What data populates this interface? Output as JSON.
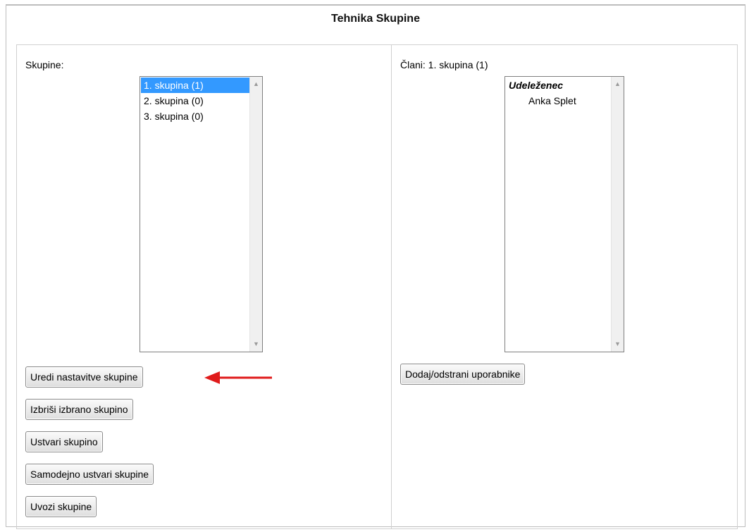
{
  "title": "Tehnika Skupine",
  "groups": {
    "label": "Skupine:",
    "items": [
      "1. skupina (1)",
      "2. skupina (0)",
      "3. skupina (0)"
    ],
    "selected_index": 0,
    "buttons": {
      "edit": "Uredi nastavitve skupine",
      "delete": "Izbriši izbrano skupino",
      "create": "Ustvari skupino",
      "auto_create": "Samodejno ustvari skupine",
      "import": "Uvozi skupine"
    }
  },
  "members": {
    "label": "Člani: 1. skupina (1)",
    "role_heading": "Udeleženec",
    "items": [
      "Anka Splet"
    ],
    "button": "Dodaj/odstrani uporabnike"
  },
  "colors": {
    "selection": "#3399ff",
    "annotation_arrow": "#e01b1b"
  },
  "icons": [
    "scroll-up-arrow-icon",
    "scroll-down-arrow-icon",
    "annotation-arrow-icon"
  ]
}
